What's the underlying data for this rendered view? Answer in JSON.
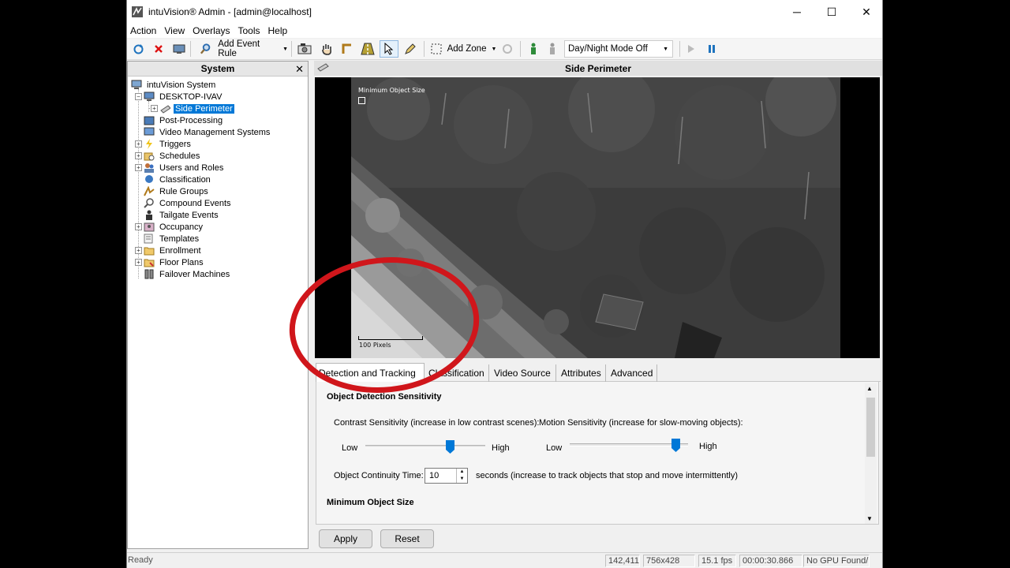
{
  "window": {
    "title": "intuVision® Admin - [admin@localhost]",
    "minimize": "─",
    "maximize": "☐",
    "close": "✕"
  },
  "menu": [
    "Action",
    "View",
    "Overlays",
    "Tools",
    "Help"
  ],
  "toolbar": {
    "add_event_rule": "Add Event Rule",
    "add_zone": "Add Zone",
    "day_night_mode": "Day/Night Mode Off"
  },
  "system_panel": {
    "title": "System",
    "close": "✕",
    "tree": [
      {
        "label": "intuVision System",
        "icon": "system-icon"
      },
      {
        "label": "DESKTOP-IVAV",
        "icon": "computer-icon"
      },
      {
        "label": "Side Perimeter",
        "icon": "camera-icon",
        "selected": true
      },
      {
        "label": "Post-Processing",
        "icon": "post-processing-icon"
      },
      {
        "label": "Video Management Systems",
        "icon": "vms-icon"
      },
      {
        "label": "Triggers",
        "icon": "lightning-icon"
      },
      {
        "label": "Schedules",
        "icon": "schedule-icon"
      },
      {
        "label": "Users and Roles",
        "icon": "users-icon"
      },
      {
        "label": "Classification",
        "icon": "classification-icon"
      },
      {
        "label": "Rule Groups",
        "icon": "rule-groups-icon"
      },
      {
        "label": "Compound Events",
        "icon": "compound-events-icon"
      },
      {
        "label": "Tailgate Events",
        "icon": "tailgate-icon"
      },
      {
        "label": "Occupancy",
        "icon": "occupancy-icon"
      },
      {
        "label": "Templates",
        "icon": "templates-icon"
      },
      {
        "label": "Enrollment",
        "icon": "enrollment-icon"
      },
      {
        "label": "Floor Plans",
        "icon": "floor-plans-icon"
      },
      {
        "label": "Failover Machines",
        "icon": "failover-icon"
      }
    ]
  },
  "video": {
    "title": "Side Perimeter",
    "overlay_min_size": "Minimum Object Size",
    "overlay_scale": "100 Pixels"
  },
  "tabs": [
    "Detection and Tracking",
    "Classification",
    "Video Source",
    "Attributes",
    "Advanced"
  ],
  "settings": {
    "section1": "Object Detection Sensitivity",
    "contrast_label": "Contrast Sensitivity (increase in low contrast scenes):",
    "motion_label": "Motion Sensitivity (increase for slow-moving objects):",
    "low": "Low",
    "high": "High",
    "contrast_value": 0.72,
    "motion_value": 0.93,
    "continuity_label": "Object Continuity Time:",
    "continuity_value": "10",
    "continuity_suffix": "seconds (increase to track objects that stop and move intermittently)",
    "section2": "Minimum Object Size"
  },
  "buttons": {
    "apply": "Apply",
    "reset": "Reset"
  },
  "status": {
    "ready": "Ready",
    "coords": "142,411",
    "resolution": "756x428",
    "fps": "15.1 fps",
    "time": "00:00:30.866",
    "gpu": "No GPU Found/Ir"
  },
  "colors": {
    "selection": "#0078d7",
    "annotation_circle": "#d0161b"
  }
}
